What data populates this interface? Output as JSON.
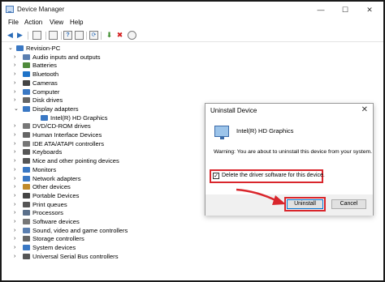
{
  "window": {
    "title": "Device Manager",
    "min_glyph": "—",
    "max_glyph": "☐",
    "close_glyph": "✕"
  },
  "menu": [
    "File",
    "Action",
    "View",
    "Help"
  ],
  "toolbar": {
    "back_glyph": "◀",
    "forward_glyph": "▶",
    "help_glyph": "?",
    "scan_glyph": "⟳",
    "remove_glyph": "✖",
    "update_glyph": "⬇"
  },
  "tree": {
    "expanded_glyph": "⌄",
    "collapsed_glyph": "›",
    "root": "Revision-PC",
    "items": [
      {
        "label": "Audio inputs and outputs",
        "icon": "speaker-icon",
        "color": "#5b7fb0"
      },
      {
        "label": "Batteries",
        "icon": "battery-icon",
        "color": "#4e8a3a"
      },
      {
        "label": "Bluetooth",
        "icon": "bluetooth-icon",
        "color": "#1e73c8"
      },
      {
        "label": "Cameras",
        "icon": "camera-icon",
        "color": "#444444"
      },
      {
        "label": "Computer",
        "icon": "computer-icon",
        "color": "#3a78c4"
      },
      {
        "label": "Disk drives",
        "icon": "disk-icon",
        "color": "#666666"
      },
      {
        "label": "Display adapters",
        "icon": "display-adapter-icon",
        "color": "#3a78c4",
        "expanded": true
      },
      {
        "label": "Intel(R) HD Graphics",
        "icon": "monitor-icon",
        "color": "#3a78c4",
        "child": true
      },
      {
        "label": "DVD/CD-ROM drives",
        "icon": "dvd-icon",
        "color": "#777777"
      },
      {
        "label": "Human Interface Devices",
        "icon": "hid-icon",
        "color": "#666666"
      },
      {
        "label": "IDE ATA/ATAPI controllers",
        "icon": "ide-icon",
        "color": "#777777"
      },
      {
        "label": "Keyboards",
        "icon": "keyboard-icon",
        "color": "#555555"
      },
      {
        "label": "Mice and other pointing devices",
        "icon": "mouse-icon",
        "color": "#555555"
      },
      {
        "label": "Monitors",
        "icon": "monitor-icon",
        "color": "#3a78c4"
      },
      {
        "label": "Network adapters",
        "icon": "network-icon",
        "color": "#3a78c4"
      },
      {
        "label": "Other devices",
        "icon": "other-device-icon",
        "color": "#c08a2a"
      },
      {
        "label": "Portable Devices",
        "icon": "portable-device-icon",
        "color": "#444444"
      },
      {
        "label": "Print queues",
        "icon": "printer-icon",
        "color": "#555555"
      },
      {
        "label": "Processors",
        "icon": "processor-icon",
        "color": "#5a6f8a"
      },
      {
        "label": "Software devices",
        "icon": "software-device-icon",
        "color": "#777777"
      },
      {
        "label": "Sound, video and game controllers",
        "icon": "sound-icon",
        "color": "#5b7fb0"
      },
      {
        "label": "Storage controllers",
        "icon": "storage-icon",
        "color": "#666666"
      },
      {
        "label": "System devices",
        "icon": "system-icon",
        "color": "#3a78c4"
      },
      {
        "label": "Universal Serial Bus controllers",
        "icon": "usb-icon",
        "color": "#555555"
      }
    ]
  },
  "dialog": {
    "title": "Uninstall Device",
    "close_glyph": "✕",
    "device_name": "Intel(R) HD Graphics",
    "warning": "Warning: You are about to uninstall this device from your system.",
    "checkbox_label": "Delete the driver software for this device.",
    "checkbox_checked": true,
    "check_glyph": "✓",
    "uninstall_label": "Uninstall",
    "cancel_label": "Cancel"
  },
  "colors": {
    "highlight": "#d9262c",
    "accent": "#0078d7"
  }
}
